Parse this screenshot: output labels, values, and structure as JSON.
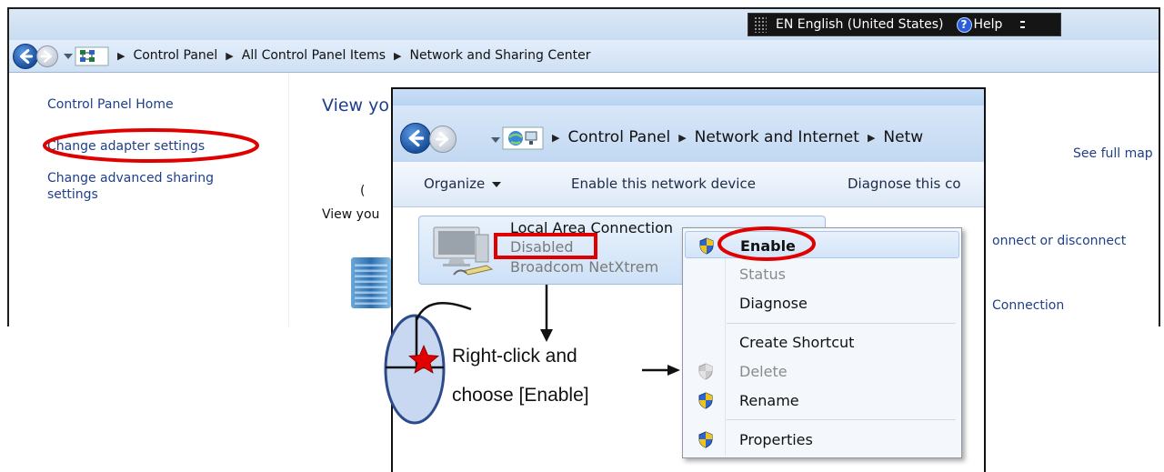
{
  "back_window": {
    "language_bar": {
      "language": "EN English (United States)",
      "help_label": "Help"
    },
    "breadcrumbs": [
      "Control Panel",
      "All Control Panel Items",
      "Network and Sharing Center"
    ],
    "sidebar": {
      "home": "Control Panel Home",
      "change_adapter": "Change adapter settings",
      "change_advanced": "Change advanced sharing settings"
    },
    "main": {
      "heading": "View yo",
      "sub": "View you",
      "paren": "(",
      "see_full_map": "See full map",
      "connect_or_disconnect": "onnect or disconnect",
      "connection": "Connection"
    }
  },
  "front_window": {
    "breadcrumbs": [
      "Control Panel",
      "Network and Internet",
      "Netw"
    ],
    "toolbar": {
      "organize": "Organize",
      "enable_device": "Enable this network device",
      "diagnose": "Diagnose this co"
    },
    "connection": {
      "name": "Local Area Connection",
      "status": "Disabled",
      "device": "Broadcom NetXtrem"
    }
  },
  "context_menu": {
    "items": [
      {
        "label": "Enable",
        "enabled": true,
        "bold": true,
        "icon": "uac-shield-icon"
      },
      {
        "label": "Status",
        "enabled": false,
        "bold": false,
        "icon": ""
      },
      {
        "label": "Diagnose",
        "enabled": true,
        "bold": false,
        "icon": ""
      },
      {
        "label": "Create Shortcut",
        "enabled": true,
        "bold": false,
        "icon": ""
      },
      {
        "label": "Delete",
        "enabled": false,
        "bold": false,
        "icon": "uac-shield-icon"
      },
      {
        "label": "Rename",
        "enabled": true,
        "bold": false,
        "icon": "uac-shield-icon"
      },
      {
        "label": "Properties",
        "enabled": true,
        "bold": false,
        "icon": "uac-shield-icon"
      }
    ]
  },
  "annotation": {
    "line1": "Right-click and",
    "line2": "choose [Enable]",
    "highlight_color": "#e00000"
  }
}
